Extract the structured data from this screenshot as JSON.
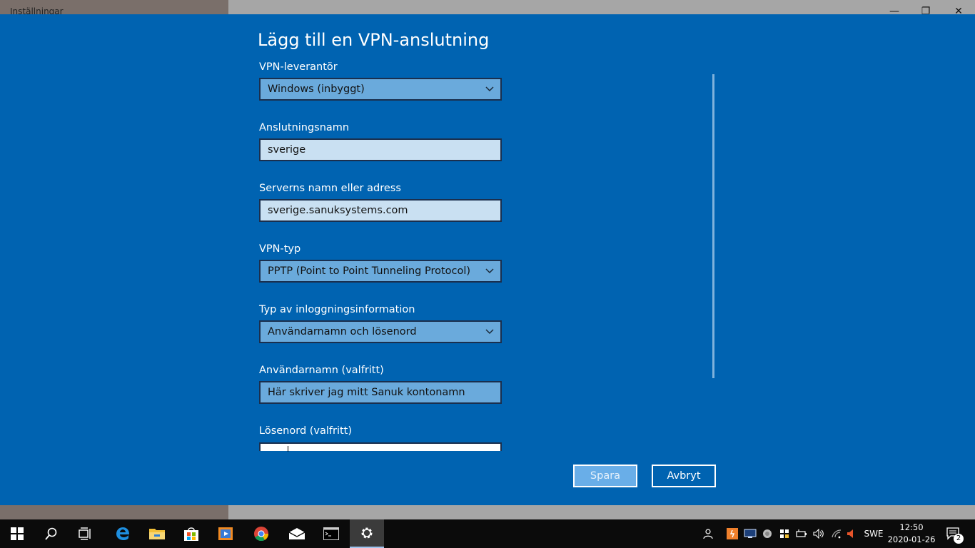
{
  "window": {
    "title": "Inställningar",
    "minimize_glyph": "—",
    "restore_glyph": "❐",
    "close_glyph": "✕"
  },
  "dialog": {
    "title": "Lägg till en VPN-anslutning",
    "provider": {
      "label": "VPN-leverantör",
      "value": "Windows (inbyggt)"
    },
    "connection_name": {
      "label": "Anslutningsnamn",
      "value": "sverige"
    },
    "server": {
      "label": "Serverns namn eller adress",
      "value": "sverige.sanuksystems.com"
    },
    "vpn_type": {
      "label": "VPN-typ",
      "value": "PPTP (Point to Point Tunneling Protocol)"
    },
    "signin_type": {
      "label": "Typ av inloggningsinformation",
      "value": "Användarnamn och lösenord"
    },
    "username": {
      "label": "Användarnamn (valfritt)",
      "value": "Här skriver jag mitt Sanuk kontonamn"
    },
    "password": {
      "label": "Lösenord (valfritt)",
      "value": ""
    },
    "save_label": "Spara",
    "cancel_label": "Avbryt"
  },
  "colors": {
    "dialog_bg": "#0063b1",
    "select_bg": "#6aaadc",
    "input_bg": "#c9e0f2",
    "save_bg": "#69aee8",
    "taskbar_bg": "#0b0b0b"
  },
  "taskbar": {
    "apps": [
      "start-icon",
      "search-icon",
      "task-view-icon",
      "edge-icon",
      "file-explorer-icon",
      "store-icon",
      "media-player-icon",
      "chrome-icon",
      "mail-icon",
      "command-prompt-icon",
      "settings-icon"
    ],
    "language": "SWE",
    "time": "12:50",
    "date": "2020-01-26",
    "notification_count": "2"
  }
}
